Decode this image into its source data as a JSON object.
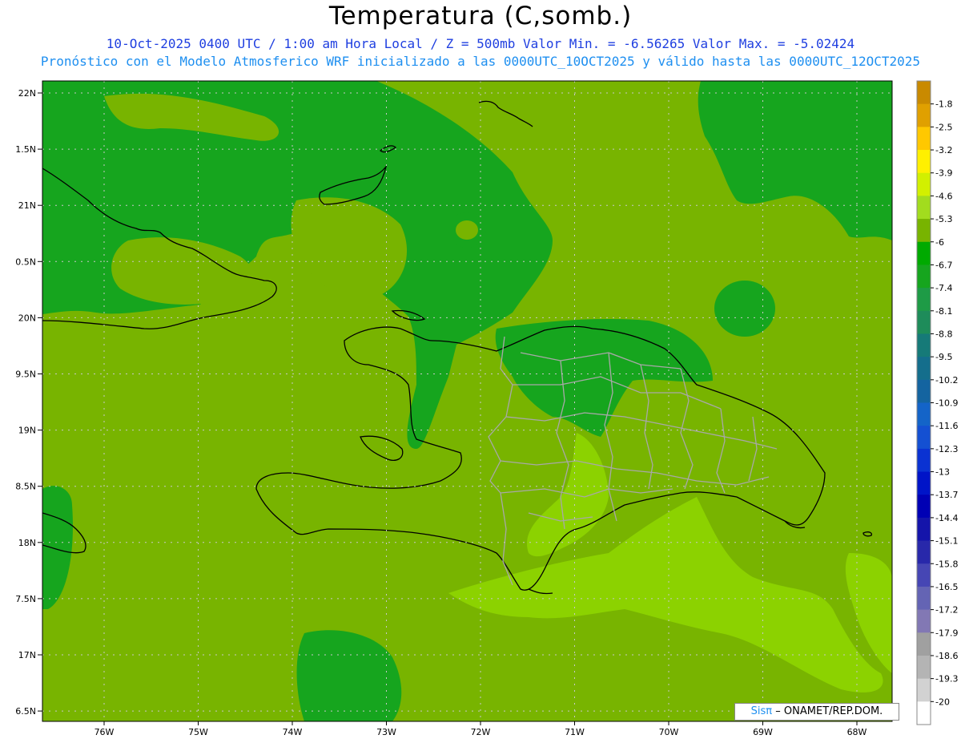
{
  "title": "Temperatura (C,somb.)",
  "subtitle_line1": "10-Oct-2025  0400 UTC / 1:00 am Hora Local / Z = 500mb  Valor Min. = -6.56265  Valor Max. = -5.02424",
  "subtitle_line2": "Pronóstico con el Modelo Atmosferico WRF inicializado a las 0000UTC_10OCT2025 y válido hasta las  0000UTC_12OCT2025",
  "map": {
    "lat_labels": [
      "22N",
      "1.5N",
      "21N",
      "0.5N",
      "20N",
      "9.5N",
      "19N",
      "8.5N",
      "18N",
      "7.5N",
      "17N",
      "6.5N"
    ],
    "lon_labels": [
      "76W",
      "75W",
      "74W",
      "73W",
      "72W",
      "71W",
      "70W",
      "69W",
      "68W"
    ],
    "credit": {
      "brand": "Sisπ",
      "text": "– ONAMET/REP.DOM."
    }
  },
  "colorbar": {
    "labels": [
      "-1.8",
      "-2.5",
      "-3.2",
      "-3.9",
      "-4.6",
      "-5.3",
      "-6",
      "-6.7",
      "-7.4",
      "-8.1",
      "-8.8",
      "-9.5",
      "-10.2",
      "-10.9",
      "-11.6",
      "-12.3",
      "-13",
      "-13.7",
      "-14.4",
      "-15.1",
      "-15.8",
      "-16.5",
      "-17.2",
      "-17.9",
      "-18.6",
      "-19.3",
      "-20"
    ],
    "colors": [
      "#c98a00",
      "#e0a000",
      "#ffc800",
      "#fff000",
      "#d2f000",
      "#a2dc1e",
      "#78b400",
      "#00aa00",
      "#16a51e",
      "#1e9b46",
      "#1e8c5a",
      "#167a78",
      "#146e8c",
      "#1464a0",
      "#1464c8",
      "#1450d2",
      "#0a32d2",
      "#0014c8",
      "#0000b4",
      "#1414aa",
      "#2828aa",
      "#4646b4",
      "#6464b4",
      "#8278b4",
      "#a0a0a0",
      "#b4b4b4",
      "#d2d2d2",
      "#ffffff"
    ]
  },
  "fill_colors": {
    "mid_green": "#78b400",
    "dark_green": "#16a51e",
    "light_green": "#8cd200"
  }
}
